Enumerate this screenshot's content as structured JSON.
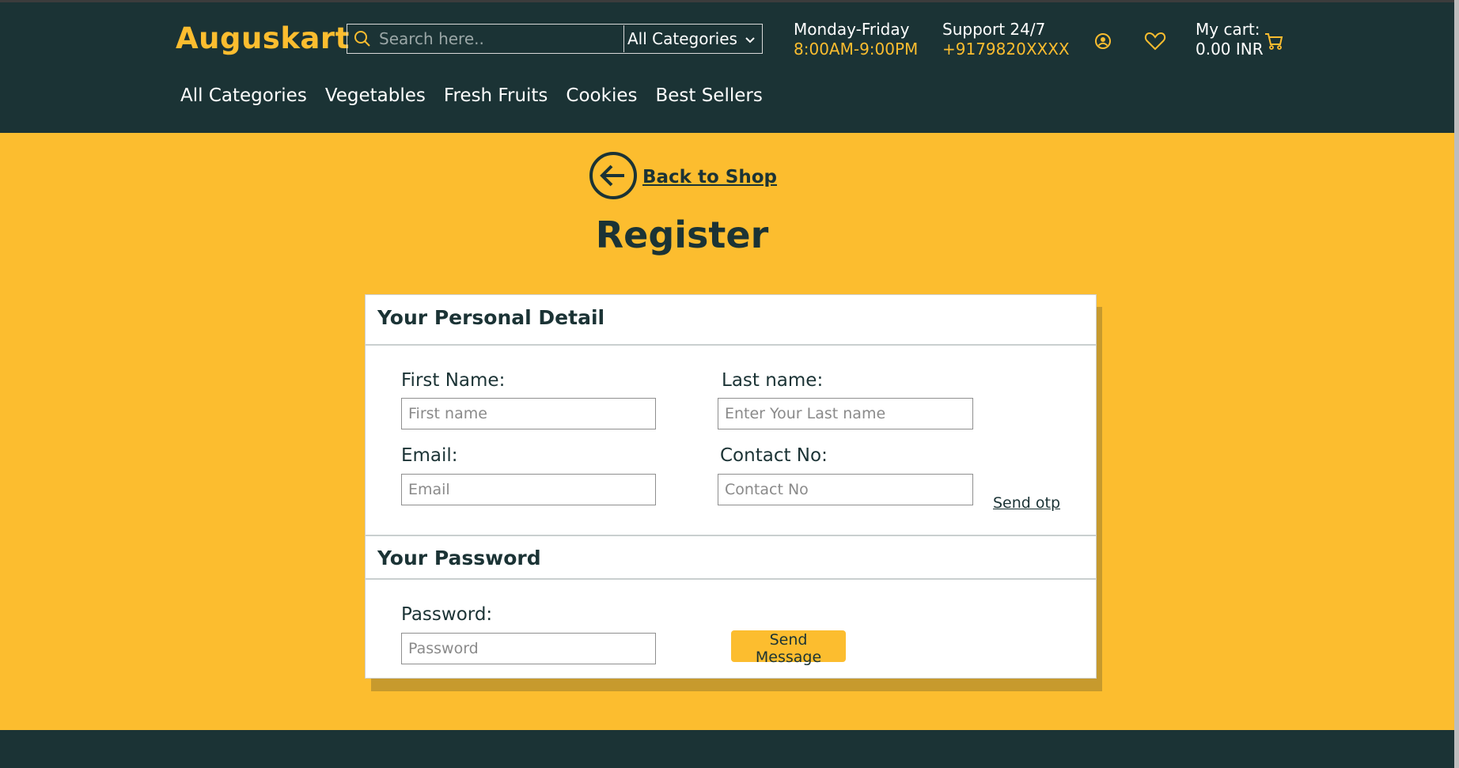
{
  "header": {
    "logo": "Auguskart",
    "search": {
      "placeholder": "Search here..",
      "category": "All Categories"
    },
    "hours": {
      "days": "Monday-Friday",
      "time": "8:00AM-9:00PM"
    },
    "support": {
      "label": "Support 24/7",
      "phone": "+9179820XXXX"
    },
    "cart": {
      "label": "My cart:",
      "amount": "0.00 INR"
    },
    "icons": [
      "search-icon",
      "chevron-down-icon",
      "user-icon",
      "heart-icon",
      "cart-icon"
    ],
    "nav": [
      "All Categories",
      "Vegetables",
      "Fresh Fruits",
      "Cookies",
      "Best Sellers"
    ]
  },
  "main": {
    "back_label": "Back to Shop",
    "title": "Register",
    "personal": {
      "title": "Your Personal Detail",
      "first_name_label": "First Name:",
      "first_name_placeholder": "First name",
      "last_name_label": "Last name:",
      "last_name_placeholder": "Enter Your Last name",
      "email_label": "Email:",
      "email_placeholder": "Email",
      "contact_label": "Contact No:",
      "contact_placeholder": "Contact No",
      "otp_link": "Send otp"
    },
    "password": {
      "title": "Your Password",
      "label": "Password:",
      "placeholder": "Password",
      "button": "Send Message"
    }
  },
  "colors": {
    "brand_dark": "#1b3335",
    "accent": "#fcbd2f"
  }
}
